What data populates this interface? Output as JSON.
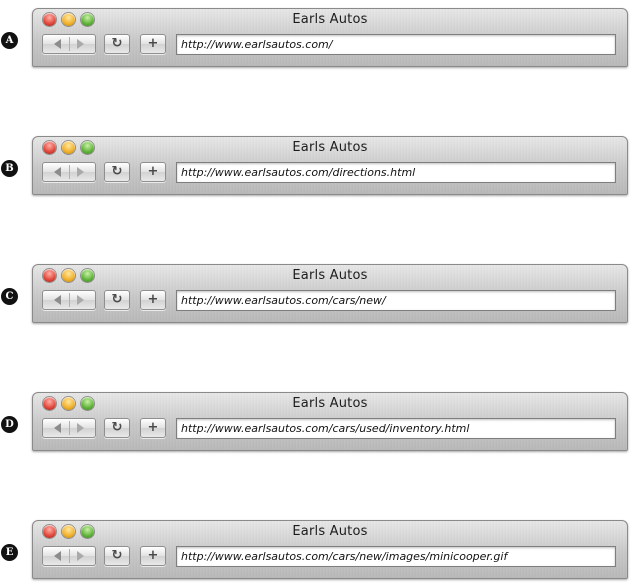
{
  "windows": [
    {
      "marker": "A",
      "title": "Earls Autos",
      "url": "http://www.earlsautos.com/"
    },
    {
      "marker": "B",
      "title": "Earls Autos",
      "url": "http://www.earlsautos.com/directions.html"
    },
    {
      "marker": "C",
      "title": "Earls Autos",
      "url": "http://www.earlsautos.com/cars/new/"
    },
    {
      "marker": "D",
      "title": "Earls Autos",
      "url": "http://www.earlsautos.com/cars/used/inventory.html"
    },
    {
      "marker": "E",
      "title": "Earls Autos",
      "url": "http://www.earlsautos.com/cars/new/images/minicooper.gif"
    }
  ],
  "icons": {
    "reload": "↻",
    "add": "+"
  },
  "colors": {
    "close": "#e0463a",
    "minimize": "#f0b02a",
    "zoom": "#5fb338"
  }
}
